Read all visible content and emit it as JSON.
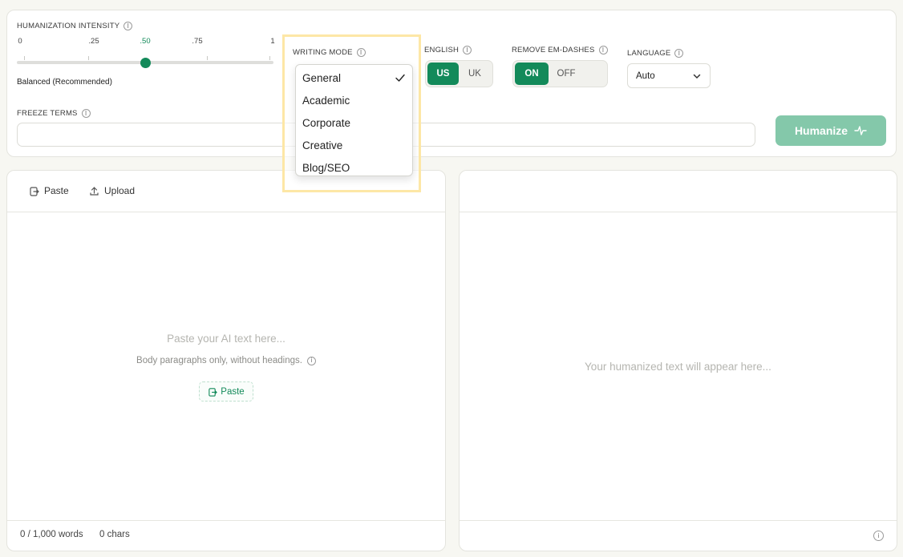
{
  "intensity": {
    "label": "HUMANIZATION INTENSITY",
    "ticks": [
      "0",
      ".25",
      ".50",
      ".75",
      "1"
    ],
    "active_tick": ".50",
    "value": 0.5,
    "caption": "Balanced (Recommended)"
  },
  "writing_mode": {
    "label": "WRITING MODE",
    "selected": "General",
    "options": [
      "General",
      "Academic",
      "Corporate",
      "Creative",
      "Blog/SEO"
    ]
  },
  "english": {
    "label": "ENGLISH",
    "options": [
      "US",
      "UK"
    ],
    "selected": "US"
  },
  "em_dashes": {
    "label": "REMOVE EM-DASHES",
    "options": [
      "ON",
      "OFF"
    ],
    "selected": "ON"
  },
  "language": {
    "label": "LANGUAGE",
    "value": "Auto"
  },
  "freeze": {
    "label": "FREEZE TERMS",
    "value": ""
  },
  "humanize_button": {
    "label": "Humanize",
    "icon": "pulse-icon"
  },
  "input_panel": {
    "paste_label": "Paste",
    "upload_label": "Upload",
    "placeholder": "Paste your AI text here...",
    "hint": "Body paragraphs only, without headings.",
    "paste_button": "Paste",
    "word_count": "0 / 1,000 words",
    "char_count": "0 chars"
  },
  "output_panel": {
    "placeholder": "Your humanized text will appear here..."
  },
  "colors": {
    "accent": "#138a5a",
    "accent_light": "#84c8aa",
    "highlight": "#fde7a6"
  }
}
